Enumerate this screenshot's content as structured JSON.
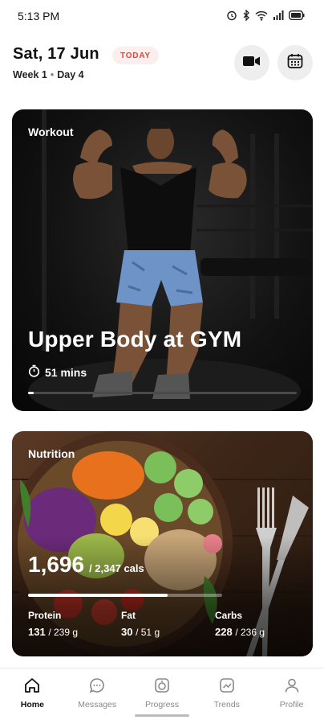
{
  "status_bar": {
    "time": "5:13 PM",
    "icons": [
      "alarm-icon",
      "bluetooth-icon",
      "wifi-icon",
      "signal-icon",
      "battery-icon"
    ]
  },
  "header": {
    "date": "Sat, 17 Jun",
    "today_badge": "TODAY",
    "week": "Week 1",
    "day": "Day 4"
  },
  "workout": {
    "label": "Workout",
    "title": "Upper Body at GYM",
    "duration": "51 mins",
    "progress": 0.02
  },
  "nutrition": {
    "label": "Nutrition",
    "calories": "1,696",
    "calorie_goal": "/ 2,347 cals",
    "calorie_progress": 0.72,
    "macros": [
      {
        "name": "Protein",
        "value": "131",
        "goal": "/ 239 g"
      },
      {
        "name": "Fat",
        "value": "30",
        "goal": "/ 51 g"
      },
      {
        "name": "Carbs",
        "value": "228",
        "goal": "/ 236 g"
      }
    ]
  },
  "bottom_nav": [
    {
      "label": "Home",
      "icon": "home-icon",
      "active": true
    },
    {
      "label": "Messages",
      "icon": "chat-icon",
      "active": false
    },
    {
      "label": "Progress",
      "icon": "progress-icon",
      "active": false
    },
    {
      "label": "Trends",
      "icon": "trends-icon",
      "active": false
    },
    {
      "label": "Profile",
      "icon": "profile-icon",
      "active": false
    }
  ],
  "colors": {
    "accent_red": "#e0463c",
    "badge_bg": "#fdeeee"
  }
}
